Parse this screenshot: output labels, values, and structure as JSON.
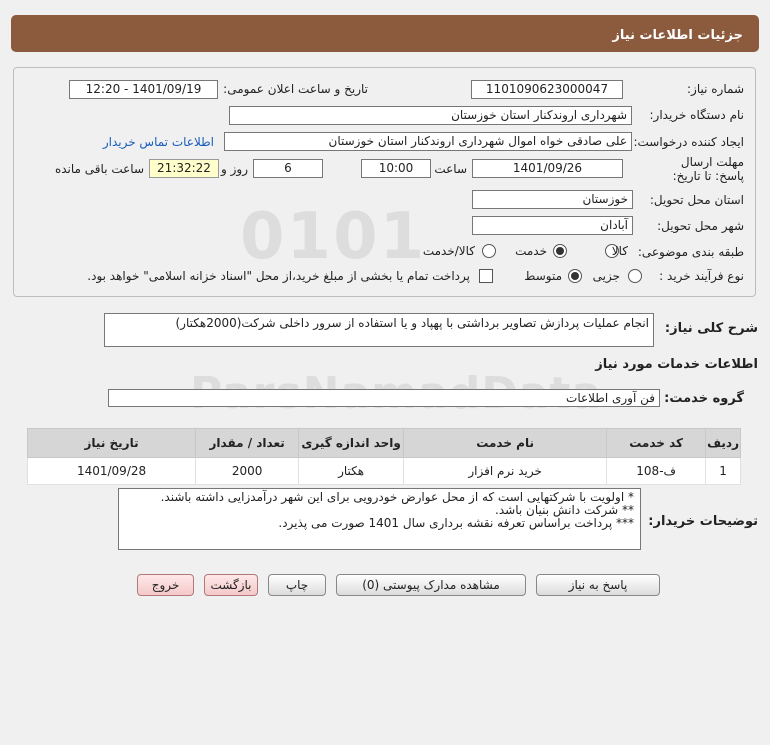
{
  "header": {
    "title": "جزئیات اطلاعات نیاز"
  },
  "form": {
    "need_number": {
      "label": "شماره نیاز:",
      "value": "1101090623000047"
    },
    "announce": {
      "label": "تاریخ و ساعت اعلان عمومی:",
      "value": "1401/09/19 - 12:20"
    },
    "buyer_org": {
      "label": "نام دستگاه خریدار:",
      "value": "شهرداری اروندکنار استان خوزستان"
    },
    "requester": {
      "label": "ایجاد کننده درخواست:",
      "value": "علی صادقی خواه اموال شهرداری اروندکنار استان خوزستان",
      "contact_link": "اطلاعات تماس خریدار"
    },
    "deadline": {
      "label": "مهلت ارسال پاسخ: تا تاریخ:",
      "date": "1401/09/26",
      "hour_label": "ساعت",
      "hour": "10:00",
      "days": "6",
      "days_label": "روز و",
      "remaining": "21:32:22",
      "remaining_label": "ساعت باقی مانده"
    },
    "province": {
      "label": "استان محل تحویل:",
      "value": "خوزستان"
    },
    "city": {
      "label": "شهر محل تحویل:",
      "value": "آبادان"
    },
    "category": {
      "label": "طبقه بندی موضوعی:",
      "options": [
        "کالا",
        "خدمت",
        "کالا/خدمت"
      ],
      "selected": "خدمت"
    },
    "process": {
      "label": "نوع فرآیند خرید :",
      "options": [
        "جزیی",
        "متوسط"
      ],
      "selected": "متوسط",
      "checkbox_label": "پرداخت تمام یا بخشی از مبلغ خرید،از محل \"اسناد خزانه اسلامی\" خواهد بود."
    }
  },
  "description": {
    "label": "شرح کلی نیاز:",
    "value": "انجام عملیات پردازش تصاویر برداشتی با پهپاد و یا استفاده از سرور داخلی شرکت(2000هکتار)"
  },
  "services_title": "اطلاعات خدمات مورد نیاز",
  "service_group": {
    "label": "گروه خدمت:",
    "value": "فن آوری اطلاعات"
  },
  "table": {
    "headers": [
      "ردیف",
      "کد خدمت",
      "نام خدمت",
      "واحد اندازه گیری",
      "تعداد / مقدار",
      "تاریخ نیاز"
    ],
    "rows": [
      [
        "1",
        "ف-108",
        "خرید نرم افزار",
        "هکتار",
        "2000",
        "1401/09/28"
      ]
    ]
  },
  "notes": {
    "label": "توضیحات خریدار:",
    "lines": [
      "*  اولویت با شرکتهایی است که از محل عوارض خودرویی برای این شهر درآمدزایی داشته باشند.",
      "** شرکت دانش بنیان باشد.",
      "*** پرداخت براساس تعرفه نقشه برداری سال 1401 صورت می پذیرد."
    ]
  },
  "buttons": {
    "reply": "پاسخ به نیاز",
    "attachments": "مشاهده مدارک پیوستی (0)",
    "print": "چاپ",
    "back": "بازگشت",
    "exit": "خروج"
  },
  "watermark": {
    "number": "0101",
    "brand": "ParsNamadData"
  }
}
